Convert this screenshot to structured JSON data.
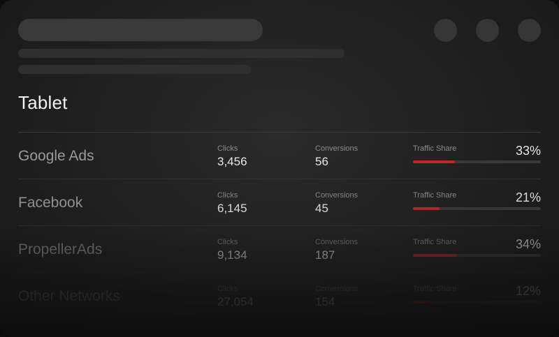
{
  "section": {
    "title": "Tablet"
  },
  "table": {
    "rows": [
      {
        "network": "Google Ads",
        "clicks_label": "Clicks",
        "clicks": "3,456",
        "conversions_label": "Conversions",
        "conversions": "56",
        "share_label": "Traffic Share",
        "share_pct": "33%",
        "share_value": 0.33
      },
      {
        "network": "Facebook",
        "clicks_label": "Clicks",
        "clicks": "6,145",
        "conversions_label": "Conversions",
        "conversions": "45",
        "share_label": "Traffic Share",
        "share_pct": "21%",
        "share_value": 0.21
      },
      {
        "network": "PropellerAds",
        "clicks_label": "Clicks",
        "clicks": "9,134",
        "conversions_label": "Conversions",
        "conversions": "187",
        "share_label": "Traffic Share",
        "share_pct": "34%",
        "share_value": 0.34
      },
      {
        "network": "Other Networks",
        "clicks_label": "Clicks",
        "clicks": "27,054",
        "conversions_label": "Conversions",
        "conversions": "154",
        "share_label": "Traffic Share",
        "share_pct": "12%",
        "share_value": 0.12
      }
    ]
  },
  "colors": {
    "accent": "#c0262a",
    "track": "#3a3a3a",
    "background": "#1f1f1f"
  }
}
